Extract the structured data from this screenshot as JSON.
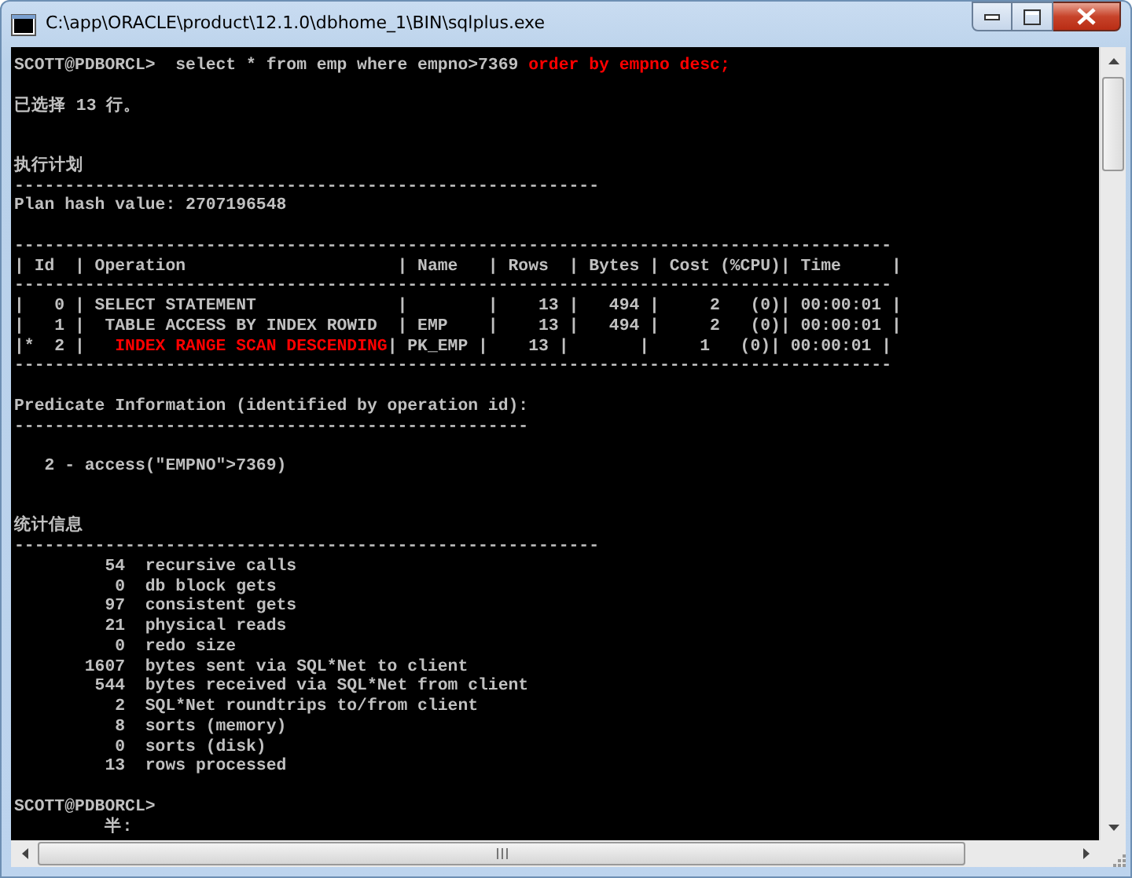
{
  "window": {
    "title": "C:\\app\\ORACLE\\product\\12.1.0\\dbhome_1\\BIN\\sqlplus.exe"
  },
  "console": [
    {
      "lines": [
        {
          "parts": [
            {
              "text": "SCOTT@PDBORCL>  select * from emp where empno>7369 ",
              "highlighted": false
            },
            {
              "text": "order by empno desc;",
              "highlighted": true
            }
          ]
        }
      ]
    },
    {
      "lines": [
        {
          "text": "已选择 13 行。"
        }
      ]
    },
    {
      "lines": [
        {
          "text": "执行计划"
        },
        {
          "text": "----------------------------------------------------------"
        },
        {
          "text": "Plan hash value: 2707196548"
        }
      ]
    },
    {
      "lines": [
        {
          "text": "---------------------------------------------------------------------------------------"
        },
        {
          "text": "| Id  | Operation                     | Name   | Rows  | Bytes | Cost (%CPU)| Time     |"
        },
        {
          "text": "---------------------------------------------------------------------------------------"
        },
        {
          "text": "|   0 | SELECT STATEMENT              |        |    13 |   494 |     2   (0)| 00:00:01 |"
        },
        {
          "text": "|   1 |  TABLE ACCESS BY INDEX ROWID  | EMP    |    13 |   494 |     2   (0)| 00:00:01 |"
        },
        {
          "parts": [
            {
              "text": "|*  2 |   ",
              "highlighted": false
            },
            {
              "text": "INDEX RANGE SCAN DESCENDING",
              "highlighted": true
            },
            {
              "text": "| PK_EMP |    13 |       |     1   (0)| 00:00:01 |",
              "highlighted": false
            }
          ]
        },
        {
          "text": "---------------------------------------------------------------------------------------"
        }
      ]
    },
    {
      "lines": [
        {
          "text": "Predicate Information (identified by operation id):"
        },
        {
          "text": "---------------------------------------------------"
        }
      ]
    },
    {
      "lines": [
        {
          "text": "   2 - access(\"EMPNO\">7369)"
        }
      ]
    },
    {
      "lines": [
        {
          "text": "统计信息"
        },
        {
          "text": "----------------------------------------------------------"
        },
        {
          "text": "         54  recursive calls"
        },
        {
          "text": "          0  db block gets"
        },
        {
          "text": "         97  consistent gets"
        },
        {
          "text": "         21  physical reads"
        },
        {
          "text": "          0  redo size"
        },
        {
          "text": "       1607  bytes sent via SQL*Net to client"
        },
        {
          "text": "        544  bytes received via SQL*Net from client"
        },
        {
          "text": "          2  SQL*Net roundtrips to/from client"
        },
        {
          "text": "          8  sorts (memory)"
        },
        {
          "text": "          0  sorts (disk)"
        },
        {
          "text": "         13  rows processed"
        }
      ]
    },
    {
      "lines": [
        {
          "text": "SCOTT@PDBORCL>"
        },
        {
          "text": "         半:"
        }
      ]
    }
  ]
}
